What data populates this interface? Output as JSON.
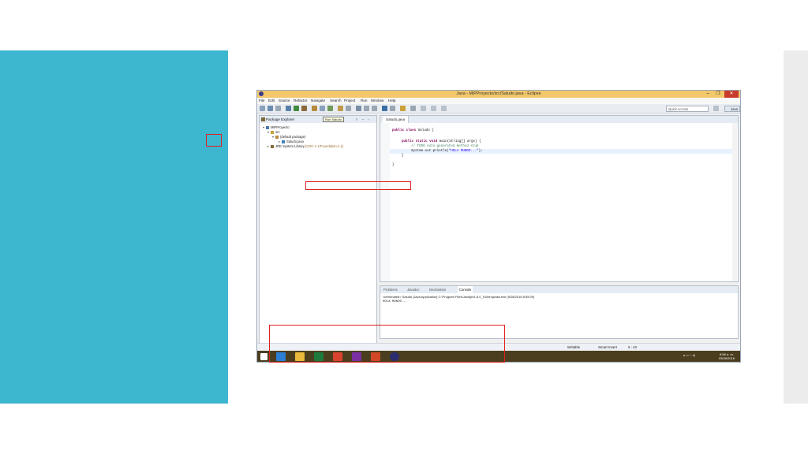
{
  "window": {
    "title": "Java - MiPProyecto/src/Saludo.java - Eclipse",
    "minimize_glyph": "–",
    "maximize_glyph": "❐",
    "close_glyph": "✕"
  },
  "menu": [
    "File",
    "Edit",
    "Source",
    "Refactor",
    "Navigate",
    "Search",
    "Project",
    "Run",
    "Window",
    "Help"
  ],
  "toolbar": {
    "quick_access_placeholder": "Quick Access",
    "perspective_label": "Java"
  },
  "package_explorer": {
    "title": "Package Explorer",
    "tooltip": "Run Saludo",
    "tree": [
      {
        "label": "MiPProyecto",
        "level": 0,
        "icon": "project-icon"
      },
      {
        "label": "src",
        "level": 1,
        "icon": "source-folder-icon"
      },
      {
        "label": "(default package)",
        "level": 2,
        "icon": "package-icon"
      },
      {
        "label": "Saludo.java",
        "level": 3,
        "icon": "java-file-icon"
      },
      {
        "label": "JRE System Library",
        "secondary": "[CDC-1.1/Foundation-1.1]",
        "level": 1,
        "icon": "library-icon"
      }
    ]
  },
  "editor": {
    "tab_label": "Saludo.java",
    "lines": {
      "l1_kw": "public class",
      "l1_rest": " Saludo {",
      "l2_kw": "public static void",
      "l2_rest": " main(String[] args) {",
      "l3": "// TODO Auto-generated method stub",
      "l4_pre": "System.out.println(",
      "l4_str": "\"HOLA MUNDO...\"",
      "l4_post": ");",
      "l5": "}",
      "l6": "}"
    }
  },
  "console": {
    "tabs": [
      "Problems",
      "Javadoc",
      "Declaration",
      "Console"
    ],
    "active_tab": "Console",
    "header": "<terminated> Saludo [Java Application] C:\\Program Files\\Java\\jre1.8.0_91\\bin\\javaw.exe (5/08/2016 8:55:09)",
    "output": "HOLA MUNDO..."
  },
  "status_bar": {
    "mode": "Writable",
    "insert": "Smart Insert",
    "position": "6 : 43"
  },
  "taskbar": {
    "apps": [
      {
        "name": "start-icon",
        "color": "#ffffff"
      },
      {
        "name": "internet-explorer-icon",
        "color": "#2a7fd4"
      },
      {
        "name": "file-explorer-icon",
        "color": "#e8b93a"
      },
      {
        "name": "excel-icon",
        "color": "#1e7a3c"
      },
      {
        "name": "chrome-icon",
        "color": "#d9432f"
      },
      {
        "name": "search-app-icon",
        "color": "#7a2fa3"
      },
      {
        "name": "powerpoint-icon",
        "color": "#d24726"
      },
      {
        "name": "eclipse-icon",
        "color": "#2c2c6e"
      }
    ],
    "clock_time": "8:56 a. m.",
    "clock_date": "05/08/2016"
  },
  "colors": {
    "slide_accent": "#3db6d0",
    "annotation": "#e02020",
    "title_bar": "#f3c86a",
    "taskbar": "#4a3e1e"
  }
}
